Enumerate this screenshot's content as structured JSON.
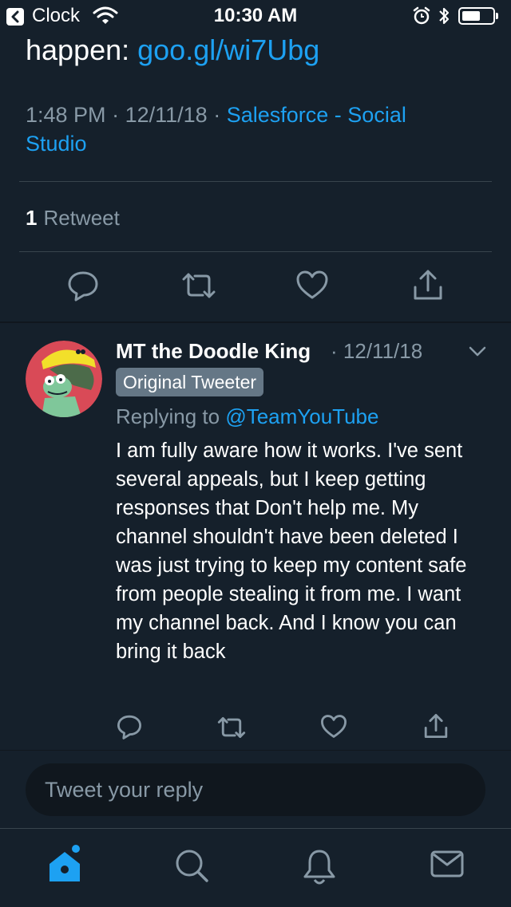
{
  "status_bar": {
    "back_app": "Clock",
    "time": "10:30 AM"
  },
  "main_tweet": {
    "text_prefix": "happen: ",
    "link": "goo.gl/wi7Ubg",
    "time": "1:48 PM",
    "date": "12/11/18",
    "separator": "·",
    "source": "Salesforce - Social Studio",
    "retweet_count": "1",
    "retweet_label": "Retweet"
  },
  "reply": {
    "author_name": "MT the Doodle King",
    "date": "12/11/18",
    "badge": "Original Tweeter",
    "replying_prefix": "Replying to ",
    "replying_handle": "@TeamYouTube",
    "body": "I am fully aware how it works. I've sent several appeals, but I keep getting responses that Don't help me. My channel shouldn't have been deleted I was just trying to keep my content safe from people stealing it from me. I want my channel back. And I know you can bring it back"
  },
  "compose": {
    "placeholder": "Tweet your reply"
  },
  "icons": {
    "actions": [
      "reply-icon",
      "retweet-icon",
      "like-icon",
      "share-icon"
    ],
    "tabs": [
      "home-icon",
      "search-icon",
      "notifications-icon",
      "messages-icon"
    ]
  },
  "colors": {
    "background": "#15202b",
    "accent": "#1da1f2",
    "secondary_text": "#8899a6",
    "divider": "#38444d"
  }
}
